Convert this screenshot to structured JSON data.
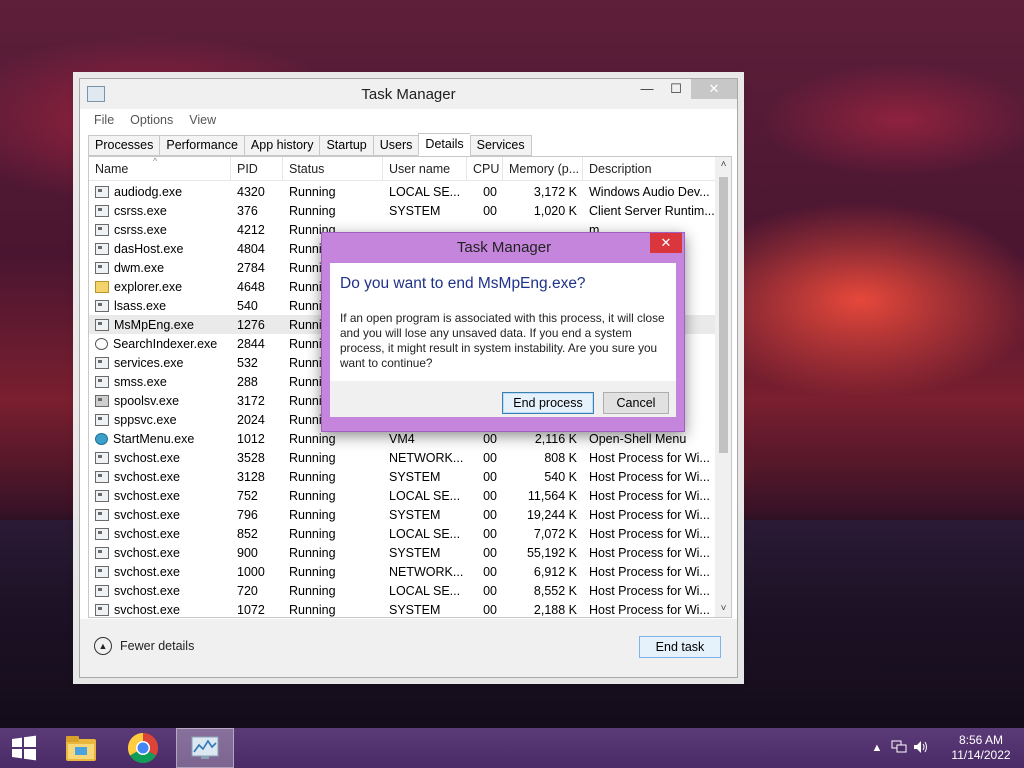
{
  "window": {
    "title": "Task Manager",
    "controls": {
      "minimize": "—",
      "maximize": "☐",
      "close": "✕"
    },
    "menu": [
      "File",
      "Options",
      "View"
    ],
    "tabs": [
      "Processes",
      "Performance",
      "App history",
      "Startup",
      "Users",
      "Details",
      "Services"
    ],
    "active_tab": "Details",
    "columns": {
      "name": "Name",
      "pid": "PID",
      "status": "Status",
      "user": "User name",
      "cpu": "CPU",
      "memory": "Memory (p...",
      "description": "Description"
    },
    "rows": [
      {
        "name": "audiodg.exe",
        "pid": "4320",
        "status": "Running",
        "user": "LOCAL SE...",
        "cpu": "00",
        "memory": "3,172 K",
        "description": "Windows Audio Dev..."
      },
      {
        "name": "csrss.exe",
        "pid": "376",
        "status": "Running",
        "user": "SYSTEM",
        "cpu": "00",
        "memory": "1,020 K",
        "description": "Client Server Runtim..."
      },
      {
        "name": "csrss.exe",
        "pid": "4212",
        "status": "Running",
        "user": "",
        "cpu": "",
        "memory": "",
        "description": "m..."
      },
      {
        "name": "dasHost.exe",
        "pid": "4804",
        "status": "Running",
        "user": "",
        "cpu": "",
        "memory": "",
        "description": "F..."
      },
      {
        "name": "dwm.exe",
        "pid": "2784",
        "status": "Running",
        "user": "",
        "cpu": "",
        "memory": "",
        "description": "M..."
      },
      {
        "name": "explorer.exe",
        "pid": "4648",
        "status": "Running",
        "user": "",
        "cpu": "",
        "memory": "",
        "description": ""
      },
      {
        "name": "lsass.exe",
        "pid": "540",
        "status": "Running",
        "user": "",
        "cpu": "",
        "memory": "",
        "description": ""
      },
      {
        "name": "MsMpEng.exe",
        "pid": "1276",
        "status": "Running",
        "user": "",
        "cpu": "",
        "memory": "",
        "description": "e..."
      },
      {
        "name": "SearchIndexer.exe",
        "pid": "2844",
        "status": "Running",
        "user": "",
        "cpu": "",
        "memory": "",
        "description": "s..."
      },
      {
        "name": "services.exe",
        "pid": "532",
        "status": "Running",
        "user": "",
        "cpu": "",
        "memory": "",
        "description": "ol..."
      },
      {
        "name": "smss.exe",
        "pid": "288",
        "status": "Running",
        "user": "",
        "cpu": "",
        "memory": "",
        "description": "M..."
      },
      {
        "name": "spoolsv.exe",
        "pid": "3172",
        "status": "Running",
        "user": "",
        "cpu": "",
        "memory": "",
        "description": ""
      },
      {
        "name": "sppsvc.exe",
        "pid": "2024",
        "status": "Running",
        "user": "",
        "cpu": "",
        "memory": "",
        "description": ""
      },
      {
        "name": "StartMenu.exe",
        "pid": "1012",
        "status": "Running",
        "user": "VM4",
        "cpu": "00",
        "memory": "2,116 K",
        "description": "Open-Shell Menu"
      },
      {
        "name": "svchost.exe",
        "pid": "3528",
        "status": "Running",
        "user": "NETWORK...",
        "cpu": "00",
        "memory": "808 K",
        "description": "Host Process for Wi..."
      },
      {
        "name": "svchost.exe",
        "pid": "3128",
        "status": "Running",
        "user": "SYSTEM",
        "cpu": "00",
        "memory": "540 K",
        "description": "Host Process for Wi..."
      },
      {
        "name": "svchost.exe",
        "pid": "752",
        "status": "Running",
        "user": "LOCAL SE...",
        "cpu": "00",
        "memory": "11,564 K",
        "description": "Host Process for Wi..."
      },
      {
        "name": "svchost.exe",
        "pid": "796",
        "status": "Running",
        "user": "SYSTEM",
        "cpu": "00",
        "memory": "19,244 K",
        "description": "Host Process for Wi..."
      },
      {
        "name": "svchost.exe",
        "pid": "852",
        "status": "Running",
        "user": "LOCAL SE...",
        "cpu": "00",
        "memory": "7,072 K",
        "description": "Host Process for Wi..."
      },
      {
        "name": "svchost.exe",
        "pid": "900",
        "status": "Running",
        "user": "SYSTEM",
        "cpu": "00",
        "memory": "55,192 K",
        "description": "Host Process for Wi..."
      },
      {
        "name": "svchost.exe",
        "pid": "1000",
        "status": "Running",
        "user": "NETWORK...",
        "cpu": "00",
        "memory": "6,912 K",
        "description": "Host Process for Wi..."
      },
      {
        "name": "svchost.exe",
        "pid": "720",
        "status": "Running",
        "user": "LOCAL SE...",
        "cpu": "00",
        "memory": "8,552 K",
        "description": "Host Process for Wi..."
      },
      {
        "name": "svchost.exe",
        "pid": "1072",
        "status": "Running",
        "user": "SYSTEM",
        "cpu": "00",
        "memory": "2,188 K",
        "description": "Host Process for Wi..."
      }
    ],
    "selected_row": "MsMpEng.exe",
    "fewer_details": "Fewer details",
    "end_task": "End task"
  },
  "dialog": {
    "title": "Task Manager",
    "close": "✕",
    "heading": "Do you want to end MsMpEng.exe?",
    "body": "If an open program is associated with this process, it will close and you will lose any unsaved data. If you end a system process, it might result in system instability. Are you sure you want to continue?",
    "end_process": "End process",
    "cancel": "Cancel"
  },
  "taskbar": {
    "apps": [
      "start-icon",
      "file-explorer-icon",
      "chrome-icon",
      "task-manager-icon"
    ],
    "tray_chevron": "▲",
    "time": "8:56 AM",
    "date": "11/14/2022"
  },
  "colors": {
    "taskbar": "#4a2b66",
    "dialog_frame": "#c685dc",
    "dialog_heading": "#1e3287",
    "close_red": "#d9363e",
    "end_task_button": "#e5f1fb"
  }
}
